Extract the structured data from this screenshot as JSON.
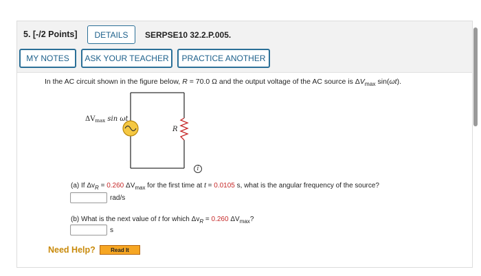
{
  "question": {
    "number_points": "5. [-/2 Points]",
    "details_label": "DETAILS",
    "code": "SERPSE10 32.2.P.005."
  },
  "actions": {
    "my_notes": "MY NOTES",
    "ask_teacher": "ASK YOUR TEACHER",
    "practice": "PRACTICE ANOTHER"
  },
  "prompt": {
    "part1": "In the AC circuit shown in the figure below, ",
    "R_symbol": "R",
    "part2": " = 70.0 Ω and the output voltage of the AC source is Δ",
    "V": "V",
    "max": "max",
    "part3": " sin(",
    "wt": "ωt",
    "part4": ")."
  },
  "figure": {
    "source_label_pre": "ΔV",
    "source_label_sub": "max",
    "source_label_post": " sin ωt",
    "resistor_label": "R"
  },
  "part_a": {
    "prefix": "(a) If Δv",
    "sub": "R",
    "eq": " = ",
    "value": "0.260",
    "mid1": " ΔV",
    "maxsub": "max",
    "mid2": " for the first time at ",
    "t": "t",
    "mid3": " = ",
    "time_value": "0.0105",
    "suffix": " s, what is the angular frequency of the source?",
    "unit": "rad/s",
    "answer": ""
  },
  "part_b": {
    "prefix": "(b) What is the next value of ",
    "t": "t",
    "mid": " for which Δv",
    "sub": "R",
    "eq": " = ",
    "value": "0.260",
    "mid2": " ΔV",
    "maxsub": "max",
    "suffix": "?",
    "unit": "s",
    "answer": ""
  },
  "help": {
    "need_help": "Need Help?",
    "read_it": "Read It"
  },
  "colors": {
    "accent": "#1b5f8a",
    "highlight_red": "#c62828",
    "help_orange": "#c98a0b",
    "read_it_bg": "#f6a623"
  }
}
